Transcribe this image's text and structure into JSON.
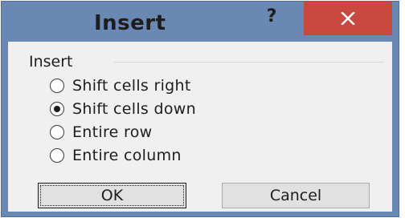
{
  "dialog": {
    "title": "Insert",
    "help_label": "?",
    "close_icon": "close-icon"
  },
  "group": {
    "label": "Insert"
  },
  "options": [
    {
      "label": "Shift cells right",
      "checked": false
    },
    {
      "label": "Shift cells down",
      "checked": true
    },
    {
      "label": "Entire row",
      "checked": false
    },
    {
      "label": "Entire column",
      "checked": false
    }
  ],
  "buttons": {
    "ok_label": "OK",
    "cancel_label": "Cancel"
  },
  "colors": {
    "titlebar": "#6a88b4",
    "close_button": "#c94840",
    "body": "#f0f0f0"
  }
}
